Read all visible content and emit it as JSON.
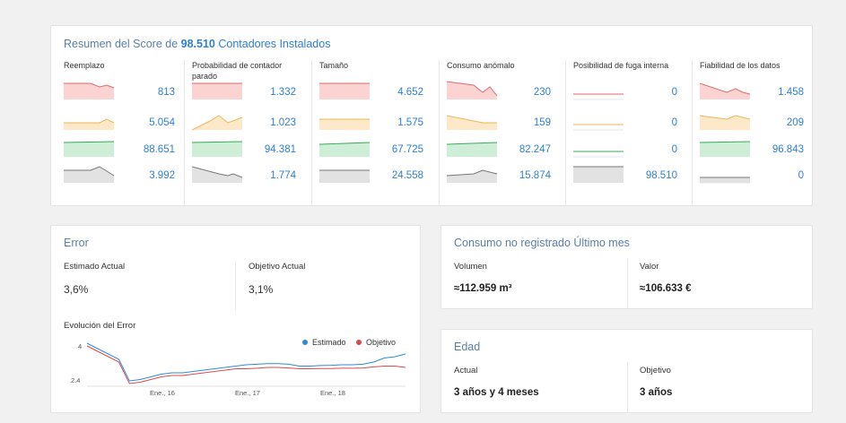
{
  "summary": {
    "title_prefix": "Resumen del Score de",
    "count": "98.510",
    "title_suffix": "Contadores Instalados",
    "columns": [
      {
        "header": "Reemplazo",
        "values": [
          "813",
          "5.054",
          "88.651",
          "3.992"
        ]
      },
      {
        "header": "Probabilidad de contador parado",
        "values": [
          "1.332",
          "1.023",
          "94.381",
          "1.774"
        ]
      },
      {
        "header": "Tamaño",
        "values": [
          "4.652",
          "1.575",
          "67.725",
          "24.558"
        ]
      },
      {
        "header": "Consumo anómalo",
        "values": [
          "230",
          "159",
          "82.247",
          "15.874"
        ]
      },
      {
        "header": "Posibilidad de fuga interna",
        "values": [
          "0",
          "0",
          "0",
          "98.510"
        ]
      },
      {
        "header": "Fiabilidad de los datos",
        "values": [
          "1.458",
          "209",
          "96.843",
          "0"
        ]
      }
    ],
    "row_colors": {
      "red": {
        "stroke": "#e06a6a",
        "fill": "#fbd3d3"
      },
      "orange": {
        "stroke": "#f0b35a",
        "fill": "#fde9c9"
      },
      "green": {
        "stroke": "#3aa85a",
        "fill": "#cfeed8"
      },
      "gray": {
        "stroke": "#777777",
        "fill": "#e2e2e2"
      }
    }
  },
  "error": {
    "title": "Error",
    "estimado_label": "Estimado Actual",
    "estimado_value": "3,6%",
    "objetivo_label": "Objetivo Actual",
    "objetivo_value": "3,1%",
    "chart_title": "Evolución del Error",
    "legend": [
      {
        "name": "Estimado",
        "color": "#2d8ad8"
      },
      {
        "name": "Objetivo",
        "color": "#d94b4b"
      }
    ],
    "y_ticks": [
      "4",
      "2.4"
    ],
    "x_ticks": [
      "Ene., 16",
      "Ene., 17",
      "Ene., 18"
    ]
  },
  "consumo": {
    "title": "Consumo no registrado Último mes",
    "volumen_label": "Volumen",
    "volumen_value": "≈112.959 m³",
    "valor_label": "Valor",
    "valor_value": "≈106.633 €"
  },
  "edad": {
    "title": "Edad",
    "actual_label": "Actual",
    "actual_value": "3 años y 4 meses",
    "objetivo_label": "Objetivo",
    "objetivo_value": "3 años"
  },
  "chart_data": {
    "type": "line",
    "title": "Evolución del Error",
    "y_tick_labels": [
      "4",
      "2.4"
    ],
    "x_tick_labels": [
      "Ene., 16",
      "Ene., 17",
      "Ene., 18"
    ],
    "legend": "top-right",
    "series": [
      {
        "name": "Estimado",
        "values": [
          4.0,
          3.8,
          3.6,
          3.4,
          2.6,
          2.65,
          2.75,
          2.85,
          2.9,
          2.9,
          2.95,
          3.0,
          3.05,
          3.1,
          3.15,
          3.2,
          3.22,
          3.24,
          3.24,
          3.22,
          3.15,
          3.15,
          3.17,
          3.18,
          3.2,
          3.2,
          3.22,
          3.3,
          3.45,
          3.5,
          3.6
        ]
      },
      {
        "name": "Objetivo",
        "values": [
          3.9,
          3.7,
          3.5,
          3.3,
          2.5,
          2.55,
          2.65,
          2.75,
          2.8,
          2.8,
          2.85,
          2.9,
          2.95,
          3.0,
          3.05,
          3.05,
          3.07,
          3.1,
          3.1,
          3.08,
          3.05,
          3.05,
          3.06,
          3.06,
          3.07,
          3.07,
          3.08,
          3.12,
          3.15,
          3.15,
          3.1
        ]
      }
    ]
  }
}
